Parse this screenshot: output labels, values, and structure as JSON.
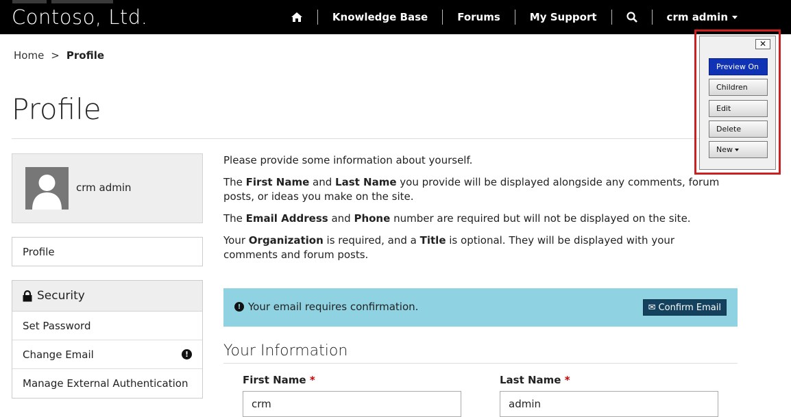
{
  "brand": "Contoso, Ltd.",
  "nav": {
    "home_icon": "home-icon",
    "items": [
      "Knowledge Base",
      "Forums",
      "My Support"
    ],
    "search_icon": "search-icon",
    "user": "crm admin"
  },
  "breadcrumb": {
    "home": "Home",
    "separator": ">",
    "current": "Profile"
  },
  "page_title": "Profile",
  "sidebar": {
    "user_name": "crm admin",
    "profile_link": "Profile",
    "security_title": "Security",
    "security_items": [
      "Set Password",
      "Change Email",
      "Manage External Authentication"
    ],
    "change_email_badge": "!"
  },
  "intro": {
    "p1": "Please provide some information about yourself.",
    "p2": [
      "The ",
      "First Name",
      " and ",
      "Last Name",
      " you provide will be displayed alongside any comments, forum posts, or ideas you make on the site."
    ],
    "p3": [
      "The ",
      "Email Address",
      " and ",
      "Phone",
      " number are required but will not be displayed on the site."
    ],
    "p4": [
      "Your ",
      "Organization",
      " is required, and a ",
      "Title",
      " is optional. They will be displayed with your comments and forum posts."
    ]
  },
  "alert": {
    "icon": "!",
    "text": "Your email requires confirmation.",
    "button": "Confirm Email"
  },
  "section_title": "Your Information",
  "fields": {
    "first_name_label": "First Name",
    "first_name_value": "crm",
    "last_name_label": "Last Name",
    "last_name_value": "admin",
    "required_mark": "*"
  },
  "toolbar": {
    "close": "✕",
    "buttons": [
      "Preview On",
      "Children",
      "Edit",
      "Delete",
      "New"
    ]
  },
  "colors": {
    "accent": "#1033b5",
    "alert_bg": "#8fd3e3",
    "outline": "#cc1f1f"
  }
}
